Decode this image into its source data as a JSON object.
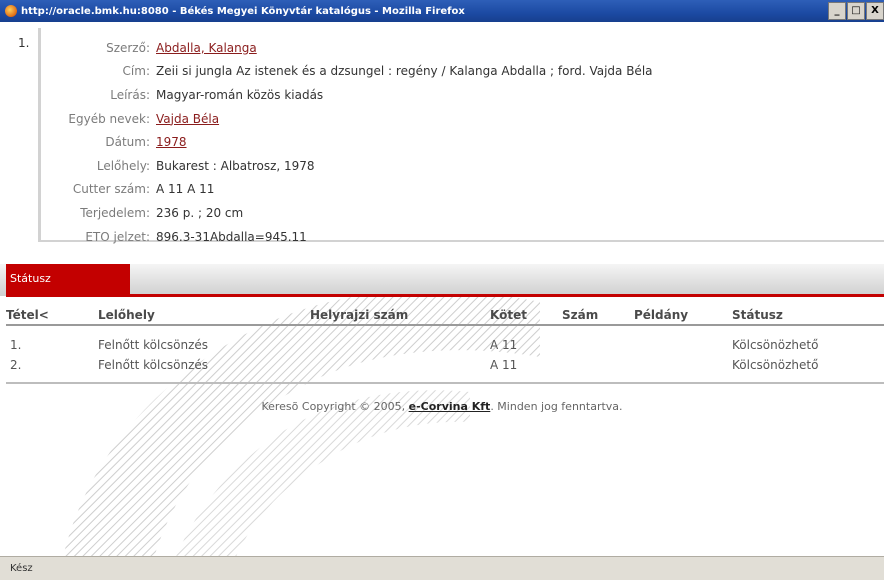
{
  "window": {
    "title": "http://oracle.bmk.hu:8080 - Békés Megyei Könyvtár katalógus - Mozilla Firefox",
    "minimize": "_",
    "maximize": "□",
    "close": "X"
  },
  "record": {
    "index": "1.",
    "fields": [
      {
        "label": "Szerző:",
        "value": "Abdalla, Kalanga",
        "link": true
      },
      {
        "label": "Cím:",
        "value": "Zeii si jungla Az istenek és a dzsungel : regény / Kalanga Abdalla ; ford. Vajda Béla",
        "link": false
      },
      {
        "label": "Leírás:",
        "value": "Magyar-román közös kiadás",
        "link": false
      },
      {
        "label": "Egyéb nevek:",
        "value": "Vajda Béla",
        "link": true
      },
      {
        "label": "Dátum:",
        "value": "1978",
        "link": true
      },
      {
        "label": "Lelőhely:",
        "value": "Bukarest : Albatrosz, 1978",
        "link": false
      },
      {
        "label": "Cutter szám:",
        "value": "A 11 A 11",
        "link": false
      },
      {
        "label": "Terjedelem:",
        "value": "236 p. ; 20 cm",
        "link": false
      },
      {
        "label": "ETO jelzet:",
        "value": "896.3-31Abdalla=945.11",
        "link": false
      }
    ]
  },
  "status_section": {
    "tab_label": "Státusz",
    "columns": [
      "Tétel<",
      "Lelőhely",
      "Helyrajzi szám",
      "Kötet",
      "Szám",
      "Példány",
      "Státusz"
    ],
    "rows": [
      {
        "item": "1.",
        "location": "Felnőtt kölcsönzés",
        "shelf": "",
        "volume": "A 11",
        "number": "",
        "copy": "",
        "status": "Kölcsönözhető"
      },
      {
        "item": "2.",
        "location": "Felnőtt kölcsönzés",
        "shelf": "",
        "volume": "A 11",
        "number": "",
        "copy": "",
        "status": "Kölcsönözhető"
      }
    ]
  },
  "footer": {
    "prefix": "Keresõ Copyright © 2005,",
    "brand": "e-Corvina Kft",
    "suffix": ". Minden jog fenntartva."
  },
  "statusbar": {
    "text": "Kész"
  }
}
